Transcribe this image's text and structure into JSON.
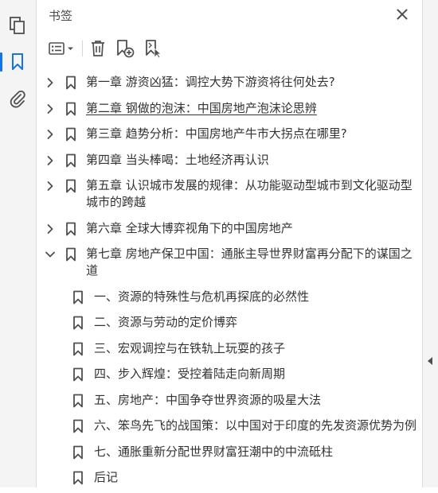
{
  "rail": {
    "icons": [
      "pages-icon",
      "bookmark-icon",
      "attachment-icon"
    ]
  },
  "panel": {
    "title": "书签",
    "toolbar": [
      "options-menu-icon",
      "delete-icon",
      "new-bookmark-icon",
      "bookmark-from-selection-icon"
    ]
  },
  "bookmarks": [
    {
      "level": 1,
      "expanded": false,
      "label": "第一章  游资凶猛：调控大势下游资将往何处去?"
    },
    {
      "level": 1,
      "expanded": false,
      "label": "第二章  钢做的泡沫：中国房地产泡沫论思辨",
      "underlined": true
    },
    {
      "level": 1,
      "expanded": false,
      "label": "第三章  趋势分析：中国房地产牛市大拐点在哪里?"
    },
    {
      "level": 1,
      "expanded": false,
      "label": "第四章  当头棒喝：土地经济再认识"
    },
    {
      "level": 1,
      "expanded": false,
      "label": "第五章  认识城市发展的规律：从功能驱动型城市到文化驱动型城市的跨越"
    },
    {
      "level": 1,
      "expanded": false,
      "label": "第六章  全球大博弈视角下的中国房地产"
    },
    {
      "level": 1,
      "expanded": true,
      "label": "第七章  房地产保卫中国：通胀主导世界财富再分配下的谋国之道"
    },
    {
      "level": 2,
      "label": "一、资源的特殊性与危机再探底的必然性"
    },
    {
      "level": 2,
      "label": "二、资源与劳动的定价博弈"
    },
    {
      "level": 2,
      "label": "三、宏观调控与在铁轨上玩耍的孩子"
    },
    {
      "level": 2,
      "label": "四、步入辉煌：受控着陆走向新周期"
    },
    {
      "level": 2,
      "label": "五、房地产：中国争夺世界资源的吸星大法"
    },
    {
      "level": 2,
      "label": "六、笨鸟先飞的战国策：以中国对于印度的先发资源优势为例"
    },
    {
      "level": 2,
      "label": "七、通胀重新分配世界财富狂潮中的中流砥柱"
    },
    {
      "level": 2,
      "label": "后记"
    }
  ],
  "colors": {
    "accent": "#1473e6",
    "text": "#333333",
    "icon": "#505050"
  }
}
